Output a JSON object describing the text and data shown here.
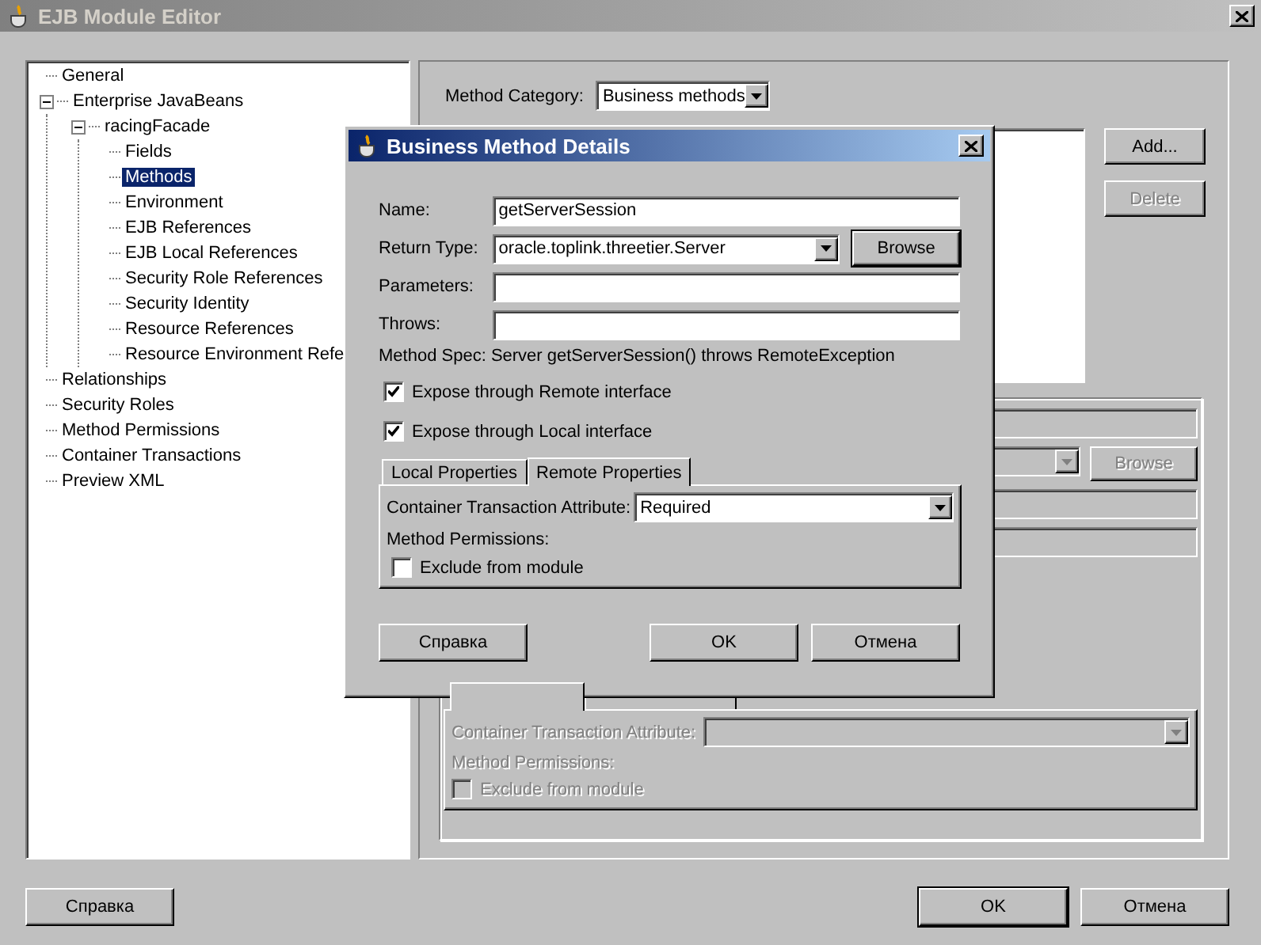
{
  "window": {
    "title": "EJB Module Editor"
  },
  "tree": [
    {
      "label": "General",
      "selected": false
    },
    {
      "label": "Enterprise JavaBeans",
      "selected": false,
      "expanded": true,
      "children": [
        {
          "label": "racingFacade",
          "selected": false,
          "expanded": true,
          "children": [
            {
              "label": "Fields",
              "selected": false
            },
            {
              "label": "Methods",
              "selected": true
            },
            {
              "label": "Environment",
              "selected": false
            },
            {
              "label": "EJB References",
              "selected": false
            },
            {
              "label": "EJB Local References",
              "selected": false
            },
            {
              "label": "Security Role References",
              "selected": false
            },
            {
              "label": "Security Identity",
              "selected": false
            },
            {
              "label": "Resource References",
              "selected": false
            },
            {
              "label": "Resource Environment Refe",
              "selected": false
            }
          ]
        }
      ]
    },
    {
      "label": "Relationships",
      "selected": false
    },
    {
      "label": "Security Roles",
      "selected": false
    },
    {
      "label": "Method Permissions",
      "selected": false
    },
    {
      "label": "Container Transactions",
      "selected": false
    },
    {
      "label": "Preview XML",
      "selected": false
    }
  ],
  "method_category": {
    "label": "Method Category:",
    "value": "Business methods"
  },
  "side_buttons": [
    {
      "label": "Add...",
      "disabled": false
    },
    {
      "label": "Delete",
      "disabled": true
    }
  ],
  "details_group": {
    "disabled": true,
    "browse_button": "Browse",
    "tabs": [
      {
        "selected": true
      },
      {
        "selected": false
      }
    ],
    "transaction_label": "Container Transaction Attribute:",
    "permissions_label": "Method Permissions:",
    "exclude": {
      "label": "Exclude from module",
      "checked": false
    }
  },
  "buttons": [
    {
      "label": "Справка",
      "default": false
    },
    {
      "label": "OK",
      "default": true
    },
    {
      "label": "Отмена",
      "default": false
    }
  ],
  "dialog": {
    "title": "Business Method Details",
    "fields": [
      {
        "label": "Name:",
        "value": "getServerSession",
        "kind": "text"
      },
      {
        "label": "Return Type:",
        "value": "oracle.toplink.threetier.Server",
        "kind": "combo"
      },
      {
        "label": "Parameters:",
        "kind": "text"
      },
      {
        "label": "Throws:",
        "kind": "text"
      }
    ],
    "browse_button": "Browse",
    "method_spec": {
      "label": "Method Spec:",
      "value": "Server getServerSession() throws RemoteException"
    },
    "checkboxes": [
      {
        "label": "Expose through Remote interface",
        "checked": true
      },
      {
        "label": "Expose through Local interface",
        "checked": true
      }
    ],
    "tabs": [
      {
        "label": "Local Properties",
        "selected": false
      },
      {
        "label": "Remote Properties",
        "selected": true
      }
    ],
    "transaction": {
      "label": "Container Transaction Attribute:",
      "value": "Required"
    },
    "permissions_label": "Method Permissions:",
    "exclude": {
      "label": "Exclude from module",
      "checked": false
    },
    "buttons": [
      {
        "label": "Справка",
        "default": false
      },
      {
        "label": "OK",
        "default": false
      },
      {
        "label": "Отмена",
        "default": false
      }
    ]
  }
}
